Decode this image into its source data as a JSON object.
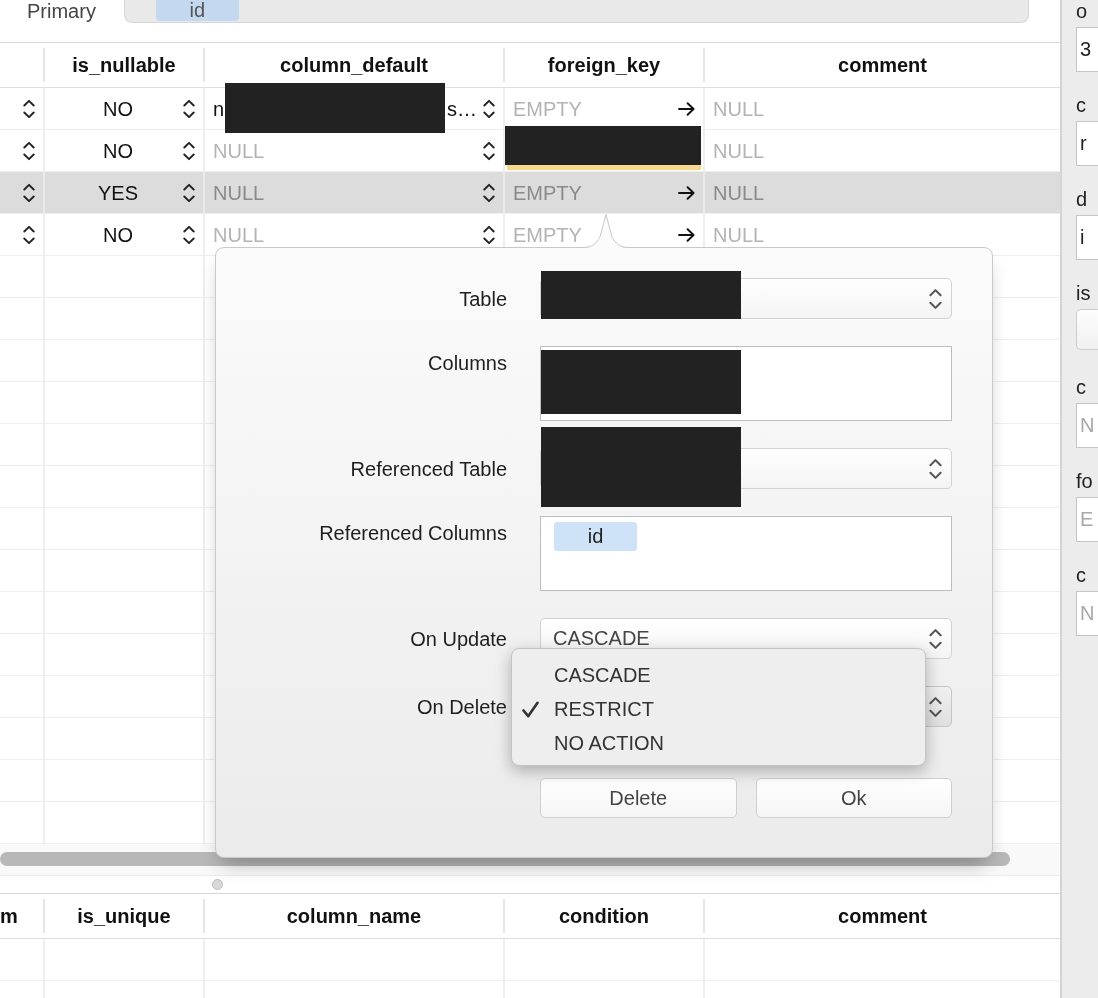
{
  "primary_key": {
    "label": "Primary",
    "tokens": [
      "id"
    ]
  },
  "columns_table": {
    "columns": [
      "is_nullable",
      "column_default",
      "foreign_key",
      "comment"
    ],
    "rows": [
      {
        "selected": false,
        "cells": [
          {
            "kind": "stepper"
          },
          {
            "kind": "choice",
            "text": "NO"
          },
          {
            "kind": "default",
            "text_start": "n",
            "redacted": true,
            "text_end": "s…",
            "is_null": false
          },
          {
            "kind": "link",
            "text": "EMPTY",
            "is_null": true,
            "modified": false
          },
          {
            "kind": "text",
            "text": "NULL",
            "is_null": true
          }
        ]
      },
      {
        "selected": false,
        "cells": [
          {
            "kind": "stepper"
          },
          {
            "kind": "choice",
            "text": "NO"
          },
          {
            "kind": "default",
            "text": "NULL",
            "is_null": true
          },
          {
            "kind": "link",
            "redacted": true,
            "modified": true
          },
          {
            "kind": "text",
            "text": "NULL",
            "is_null": true
          }
        ]
      },
      {
        "selected": true,
        "cells": [
          {
            "kind": "stepper"
          },
          {
            "kind": "choice",
            "text": "YES"
          },
          {
            "kind": "default",
            "text": "NULL",
            "is_null": true
          },
          {
            "kind": "link",
            "text": "EMPTY",
            "is_null": true,
            "modified": false
          },
          {
            "kind": "text",
            "text": "NULL",
            "is_null": true
          }
        ]
      },
      {
        "selected": false,
        "cells": [
          {
            "kind": "stepper"
          },
          {
            "kind": "choice",
            "text": "NO"
          },
          {
            "kind": "default",
            "text": "NULL",
            "is_null": true
          },
          {
            "kind": "link",
            "text": "EMPTY",
            "is_null": true,
            "modified": false
          },
          {
            "kind": "text",
            "text": "NULL",
            "is_null": true
          }
        ]
      }
    ]
  },
  "indexes_table": {
    "cut_column": "m",
    "columns": [
      "is_unique",
      "column_name",
      "condition",
      "comment"
    ]
  },
  "foreign_key_popover": {
    "fields": [
      {
        "kind": "select",
        "label": "Table",
        "redacted": true,
        "expanded": false
      },
      {
        "kind": "list",
        "label": "Columns",
        "redacted": true
      },
      {
        "kind": "select",
        "label": "Referenced Table",
        "redacted": true,
        "expanded": false
      },
      {
        "kind": "list",
        "label": "Referenced Columns",
        "tokens": [
          "id"
        ]
      },
      {
        "kind": "select",
        "label": "On Update",
        "value": "CASCADE",
        "expanded": false
      },
      {
        "kind": "select",
        "label": "On Delete",
        "expanded": true,
        "options": [
          {
            "label": "CASCADE",
            "selected": false
          },
          {
            "label": "RESTRICT",
            "selected": true
          },
          {
            "label": "NO ACTION",
            "selected": false
          }
        ]
      }
    ],
    "buttons": [
      "Delete",
      "Ok"
    ]
  },
  "inspector": {
    "fields": [
      {
        "kind": "text",
        "label": "o",
        "value": "3",
        "is_null": false
      },
      {
        "kind": "text",
        "label": "c",
        "value": "r",
        "is_null": false
      },
      {
        "kind": "text",
        "label": "d",
        "value": "i",
        "is_null": false
      },
      {
        "kind": "select",
        "label": "is"
      },
      {
        "kind": "text",
        "label": "c",
        "value": "N",
        "is_null": true
      },
      {
        "kind": "text",
        "label": "fo",
        "value": "E",
        "is_null": true
      },
      {
        "kind": "text",
        "label": "c",
        "value": "N",
        "is_null": true
      }
    ]
  }
}
